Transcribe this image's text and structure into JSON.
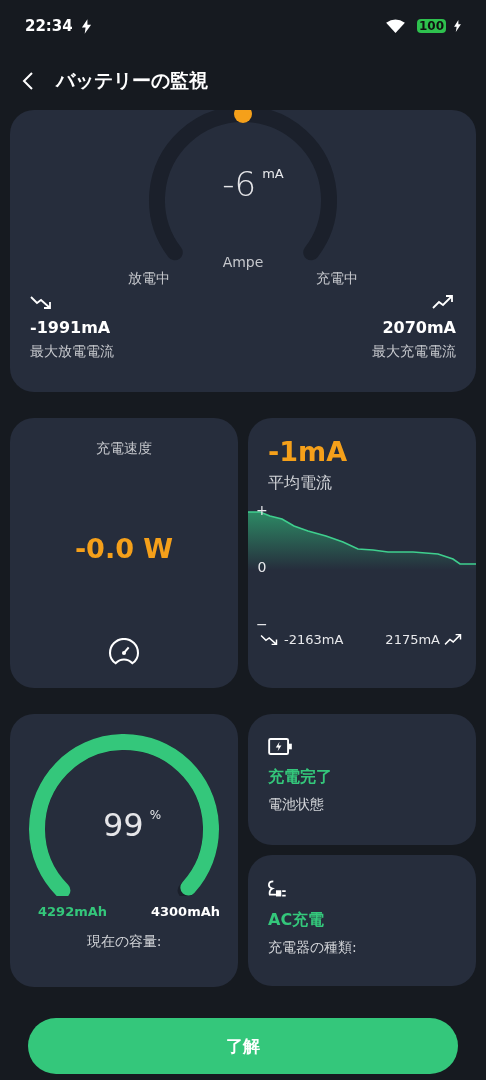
{
  "status_bar": {
    "time": "22:34",
    "battery": "100"
  },
  "header": {
    "title": "バッテリーの監視"
  },
  "ampere": {
    "value": "-6",
    "unit": "mA",
    "label": "Ampe",
    "left_label": "放電中",
    "right_label": "充電中",
    "min": {
      "value": "-1991mA",
      "label": "最大放電電流"
    },
    "max": {
      "value": "2070mA",
      "label": "最大充電電流"
    }
  },
  "power": {
    "label": "充電速度",
    "value": "-0.0 W"
  },
  "average": {
    "value": "-1mA",
    "label": "平均電流",
    "axis": [
      "+",
      "0",
      "−"
    ],
    "min": "-2163mA",
    "max": "2175mA"
  },
  "capacity": {
    "percent": "99",
    "unit": "%",
    "current": "4292mAh",
    "total": "4300mAh",
    "label": "現在の容量:"
  },
  "status_cards": [
    {
      "kind": "battery",
      "value": "充電完了",
      "label": "電池状態"
    },
    {
      "kind": "plug",
      "value": "AC充電",
      "label": "充電器の種類:"
    }
  ],
  "button": "了解"
}
